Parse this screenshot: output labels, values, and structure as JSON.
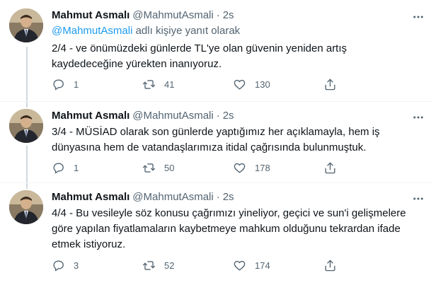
{
  "tweets": [
    {
      "name": "Mahmut Asmalı",
      "handle": "@MahmutAsmali",
      "dot": "·",
      "time": "2s",
      "reply_mention": "@MahmutAsmali",
      "reply_suffix": " adlı kişiye yanıt olarak",
      "text": "2/4 - ve önümüzdeki günlerde TL'ye olan güvenin yeniden artış kaydedeceğine yürekten inanıyoruz.",
      "replies": "1",
      "retweets": "41",
      "likes": "130"
    },
    {
      "name": "Mahmut Asmalı",
      "handle": "@MahmutAsmali",
      "dot": "·",
      "time": "2s",
      "text": "3/4 - MÜSİAD olarak son günlerde yaptığımız her açıklamayla, hem iş dünyasına hem de vatandaşlarımıza itidal çağrısında bulunmuştuk.",
      "replies": "1",
      "retweets": "50",
      "likes": "178"
    },
    {
      "name": "Mahmut Asmalı",
      "handle": "@MahmutAsmali",
      "dot": "·",
      "time": "2s",
      "text": "4/4 - Bu vesileyle söz konusu çağrımızı yineliyor, geçici ve sun'i gelişmelere göre yapılan fiyatlamaların kaybetmeye mahkum olduğunu tekrardan ifade etmek istiyoruz.",
      "replies": "3",
      "retweets": "52",
      "likes": "174"
    }
  ],
  "icons": {
    "reply": "reply-icon",
    "retweet": "retweet-icon",
    "like": "heart-icon",
    "share": "share-icon",
    "more": "more-icon"
  },
  "colors": {
    "link": "#1d9bf0",
    "secondary_text": "#536471",
    "primary_text": "#0f1419",
    "thread_line": "#cfd9de"
  }
}
